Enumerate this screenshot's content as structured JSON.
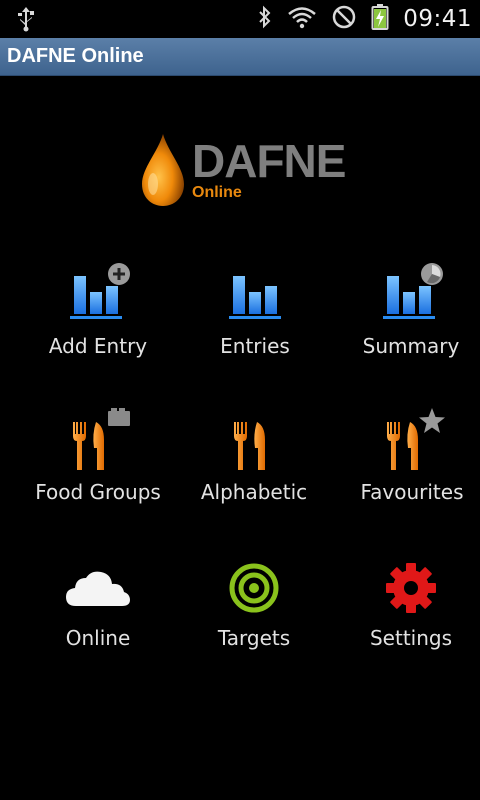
{
  "status_bar": {
    "time": "09:41",
    "icons": [
      "usb-icon",
      "bluetooth-icon",
      "wifi-icon",
      "no-signal-icon",
      "battery-charging-icon"
    ]
  },
  "title_bar": {
    "title": "DAFNE Online"
  },
  "logo": {
    "word": "DAFNE",
    "sub": "Online",
    "accent": "#e9890f"
  },
  "menu": {
    "items": [
      {
        "label": "Add Entry",
        "icon": "chart-add-icon"
      },
      {
        "label": "Entries",
        "icon": "chart-icon"
      },
      {
        "label": "Summary",
        "icon": "chart-pie-icon"
      },
      {
        "label": "Food Groups",
        "icon": "cutlery-groups-icon"
      },
      {
        "label": "Alphabetic",
        "icon": "cutlery-icon"
      },
      {
        "label": "Favourites",
        "icon": "cutlery-star-icon"
      },
      {
        "label": "Online",
        "icon": "cloud-icon"
      },
      {
        "label": "Targets",
        "icon": "target-icon"
      },
      {
        "label": "Settings",
        "icon": "gear-icon"
      }
    ]
  },
  "colors": {
    "title_bar": "#4a6f9a",
    "chart_blue": "#2a8cf0",
    "cutlery_orange": "#f07a10",
    "target_green": "#8ac21c",
    "gear_red": "#e01818"
  }
}
